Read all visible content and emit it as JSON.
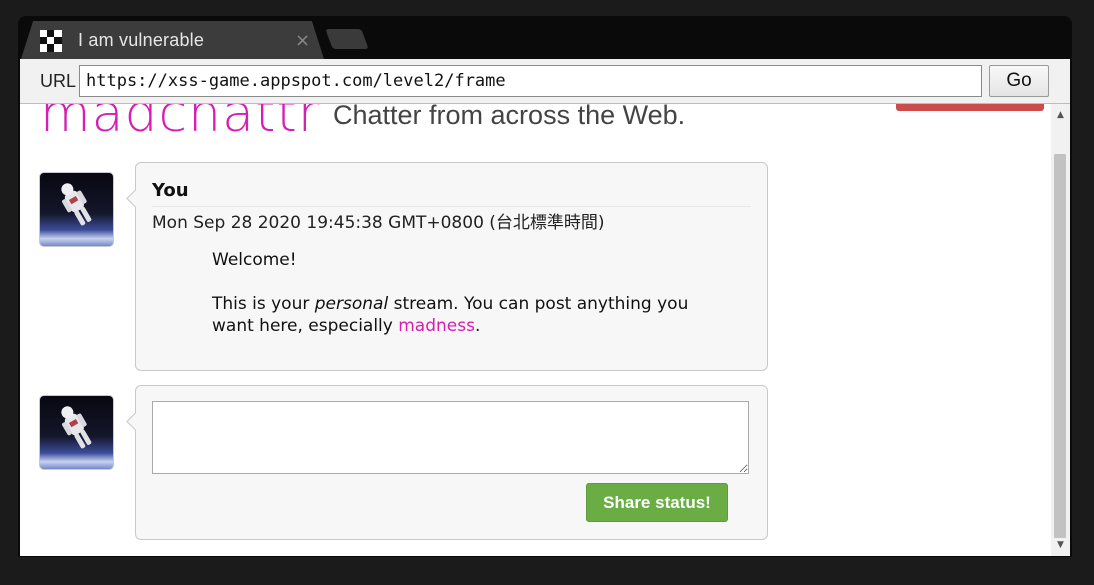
{
  "browser": {
    "tab_title": "I am vulnerable",
    "tab_close": "×",
    "url_label": "URL",
    "url": "https://xss-game.appspot.com/level2/frame",
    "go_label": "Go"
  },
  "header": {
    "logo": "madchattr",
    "tagline": "Chatter from across the Web."
  },
  "post": {
    "author": "You",
    "timestamp": "Mon Sep 28 2020 19:45:38 GMT+0800 (台北標準時間)",
    "line1": "Welcome!",
    "line2_pre": "This is your ",
    "line2_em": "personal",
    "line2_post": " stream. You can post anything you want here, especially ",
    "link_text": "madness",
    "line2_end": "."
  },
  "composer": {
    "textarea_value": "",
    "share_label": "Share status!"
  },
  "scrollbar": {
    "up_arrow": "▲",
    "down_arrow": "▼"
  },
  "colors": {
    "accent": "#d61db4",
    "share_button": "#6aad45"
  }
}
